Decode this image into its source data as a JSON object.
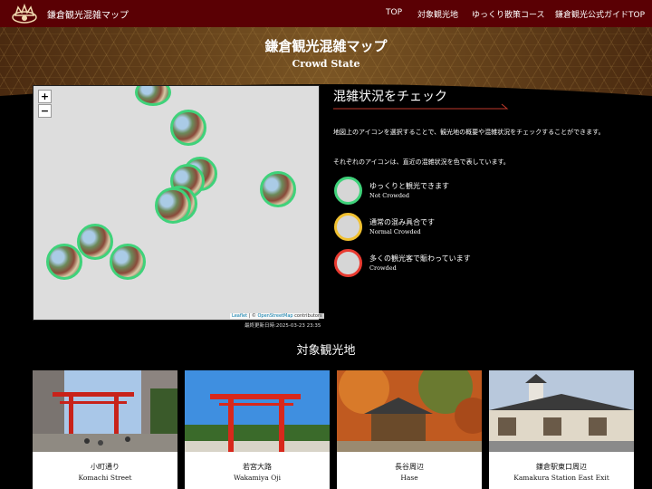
{
  "nav": {
    "site_name": "鎌倉観光混雑マップ",
    "links": [
      "TOP",
      "対象観光地",
      "ゆっくり散策コース",
      "鎌倉観光公式ガイドTOP"
    ]
  },
  "hero": {
    "title": "鎌倉観光混雑マップ",
    "subtitle": "Crowd State"
  },
  "map": {
    "zoom_in": "+",
    "zoom_out": "−",
    "attribution_leaflet": "Leaflet",
    "attribution_sep": " | © ",
    "attribution_osm": "OpenStreetMap",
    "attribution_rest": " contributors",
    "last_updated": "最終更新日時:2025-03-23 23:35"
  },
  "panel": {
    "title": "混雑状況をチェック",
    "desc1": "地図上のアイコンを選択することで、観光地の概要や混雑状況をチェックすることができます。",
    "desc2": "それぞれのアイコンは、直近の混雑状況を色で表しています。",
    "legend": [
      {
        "jp": "ゆっくりと観光できます",
        "en": "Not Crowded",
        "color": "#3fd27a"
      },
      {
        "jp": "通常の混み具合です",
        "en": "Normal Crowded",
        "color": "#f0c030"
      },
      {
        "jp": "多くの観光客で賑わっています",
        "en": "Crowded",
        "color": "#e83a30"
      }
    ]
  },
  "spots": {
    "title": "対象観光地",
    "cards": [
      {
        "jp": "小町通り",
        "en": "Komachi Street"
      },
      {
        "jp": "若宮大路",
        "en": "Wakamiya Oji"
      },
      {
        "jp": "長谷周辺",
        "en": "Hase"
      },
      {
        "jp": "鎌倉駅東口周辺",
        "en": "Kamakura Station East Exit"
      }
    ]
  },
  "colors": {
    "nav_bg": "#5a0004",
    "accent_rule": "#c0392b",
    "marker_border": "#3fd27a"
  }
}
